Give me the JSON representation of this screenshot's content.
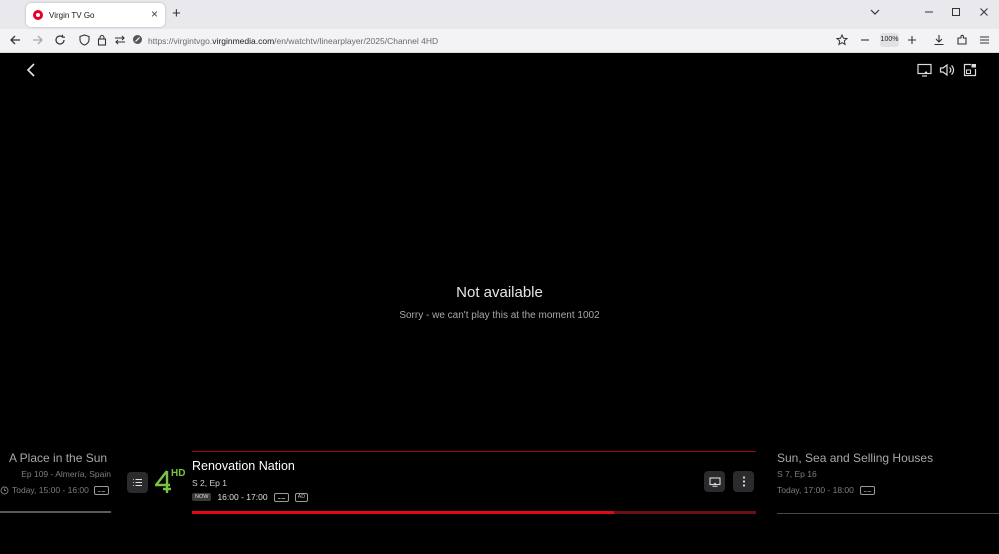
{
  "browser": {
    "tab_title": "Virgin TV Go",
    "url_prefix": "https://virgintvgo.",
    "url_domain": "virginmedia.com",
    "url_path": "/en/watchtv/linearplayer/2025/Channel 4HD",
    "zoom": "100%"
  },
  "player": {
    "message_title": "Not available",
    "message_subtitle": "Sorry - we can't play this at the moment 1002",
    "channel_logo_text": "HD",
    "previous": {
      "title": "A Place in the Sun",
      "episode": "Ep 109 - Almería, Spain",
      "time": "Today, 15:00 - 16:00"
    },
    "current": {
      "title": "Renovation Nation",
      "episode": "S 2, Ep 1",
      "now_label": "NOW",
      "time": "16:00 - 17:00",
      "ad_label": "AD",
      "progress": 0.748
    },
    "next": {
      "title": "Sun, Sea and Selling Houses",
      "episode": "S 7, Ep 16",
      "time": "Today, 17:00 - 18:00"
    }
  },
  "colors": {
    "accent": "#e10a14",
    "logo_green": "#7bc142"
  }
}
